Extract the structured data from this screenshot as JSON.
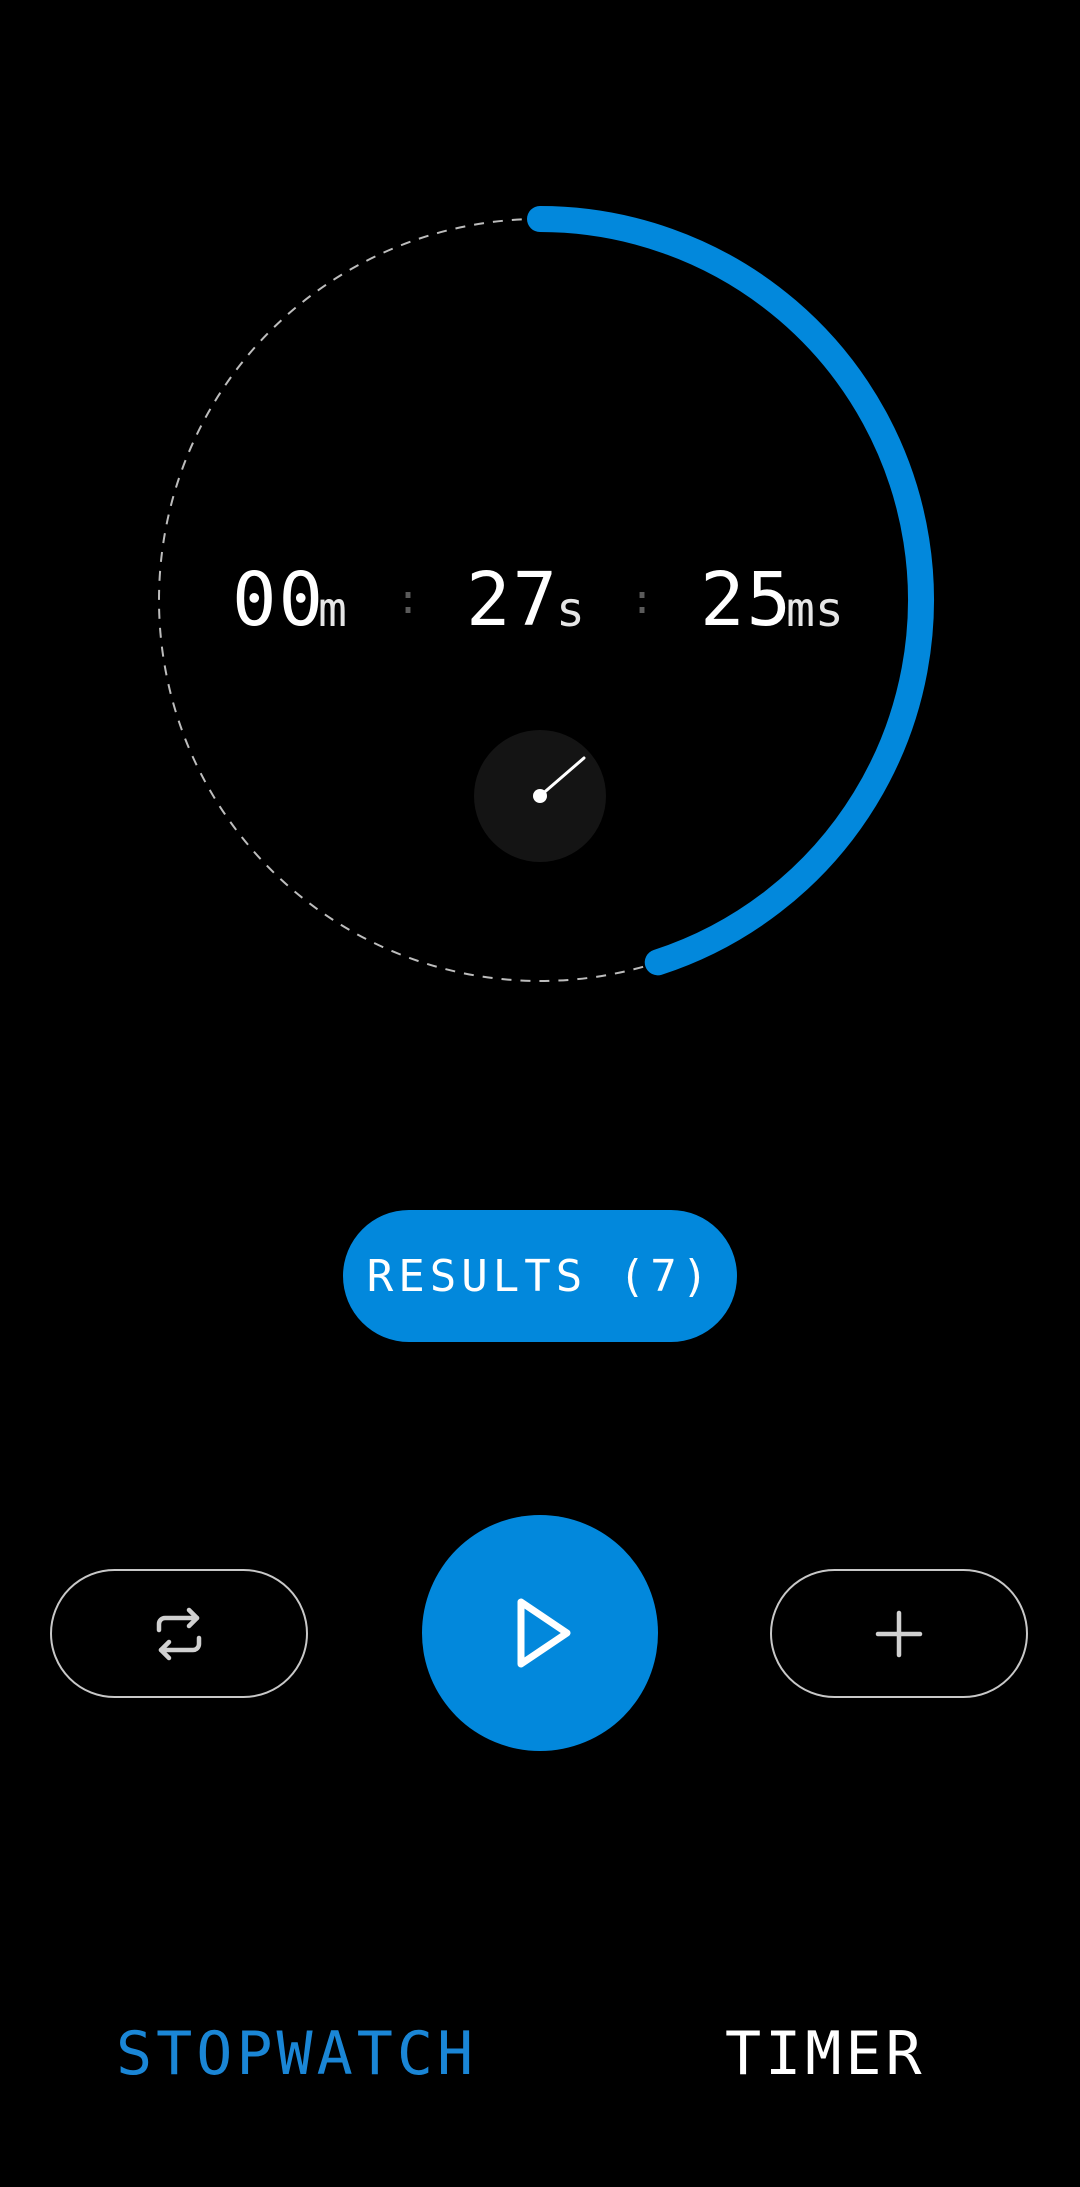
{
  "colors": {
    "accent": "#0288dc",
    "background": "#000000",
    "active_tab": "#1a86d6",
    "inactive_tab": "#ffffff",
    "outline": "#c8c8c8"
  },
  "stopwatch": {
    "minutes": "00",
    "minutes_unit": "m",
    "seconds": "27",
    "seconds_unit": "s",
    "millis": "25",
    "millis_unit": "ms",
    "separator": ":",
    "progress_fraction": 0.45
  },
  "results_button": {
    "label": "RESULTS (7)"
  },
  "controls": {
    "left_icon": "repeat-icon",
    "center_icon": "play-icon",
    "right_icon": "plus-icon"
  },
  "tabs": [
    {
      "label": "STOPWATCH",
      "active": true
    },
    {
      "label": "TIMER",
      "active": false
    }
  ]
}
